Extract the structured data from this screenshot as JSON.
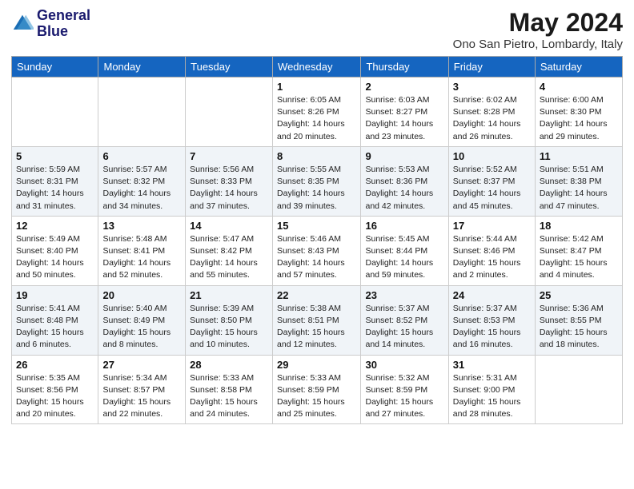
{
  "logo": {
    "line1": "General",
    "line2": "Blue"
  },
  "title": "May 2024",
  "location": "Ono San Pietro, Lombardy, Italy",
  "days_of_week": [
    "Sunday",
    "Monday",
    "Tuesday",
    "Wednesday",
    "Thursday",
    "Friday",
    "Saturday"
  ],
  "weeks": [
    [
      {
        "day": "",
        "info": ""
      },
      {
        "day": "",
        "info": ""
      },
      {
        "day": "",
        "info": ""
      },
      {
        "day": "1",
        "info": "Sunrise: 6:05 AM\nSunset: 8:26 PM\nDaylight: 14 hours\nand 20 minutes."
      },
      {
        "day": "2",
        "info": "Sunrise: 6:03 AM\nSunset: 8:27 PM\nDaylight: 14 hours\nand 23 minutes."
      },
      {
        "day": "3",
        "info": "Sunrise: 6:02 AM\nSunset: 8:28 PM\nDaylight: 14 hours\nand 26 minutes."
      },
      {
        "day": "4",
        "info": "Sunrise: 6:00 AM\nSunset: 8:30 PM\nDaylight: 14 hours\nand 29 minutes."
      }
    ],
    [
      {
        "day": "5",
        "info": "Sunrise: 5:59 AM\nSunset: 8:31 PM\nDaylight: 14 hours\nand 31 minutes."
      },
      {
        "day": "6",
        "info": "Sunrise: 5:57 AM\nSunset: 8:32 PM\nDaylight: 14 hours\nand 34 minutes."
      },
      {
        "day": "7",
        "info": "Sunrise: 5:56 AM\nSunset: 8:33 PM\nDaylight: 14 hours\nand 37 minutes."
      },
      {
        "day": "8",
        "info": "Sunrise: 5:55 AM\nSunset: 8:35 PM\nDaylight: 14 hours\nand 39 minutes."
      },
      {
        "day": "9",
        "info": "Sunrise: 5:53 AM\nSunset: 8:36 PM\nDaylight: 14 hours\nand 42 minutes."
      },
      {
        "day": "10",
        "info": "Sunrise: 5:52 AM\nSunset: 8:37 PM\nDaylight: 14 hours\nand 45 minutes."
      },
      {
        "day": "11",
        "info": "Sunrise: 5:51 AM\nSunset: 8:38 PM\nDaylight: 14 hours\nand 47 minutes."
      }
    ],
    [
      {
        "day": "12",
        "info": "Sunrise: 5:49 AM\nSunset: 8:40 PM\nDaylight: 14 hours\nand 50 minutes."
      },
      {
        "day": "13",
        "info": "Sunrise: 5:48 AM\nSunset: 8:41 PM\nDaylight: 14 hours\nand 52 minutes."
      },
      {
        "day": "14",
        "info": "Sunrise: 5:47 AM\nSunset: 8:42 PM\nDaylight: 14 hours\nand 55 minutes."
      },
      {
        "day": "15",
        "info": "Sunrise: 5:46 AM\nSunset: 8:43 PM\nDaylight: 14 hours\nand 57 minutes."
      },
      {
        "day": "16",
        "info": "Sunrise: 5:45 AM\nSunset: 8:44 PM\nDaylight: 14 hours\nand 59 minutes."
      },
      {
        "day": "17",
        "info": "Sunrise: 5:44 AM\nSunset: 8:46 PM\nDaylight: 15 hours\nand 2 minutes."
      },
      {
        "day": "18",
        "info": "Sunrise: 5:42 AM\nSunset: 8:47 PM\nDaylight: 15 hours\nand 4 minutes."
      }
    ],
    [
      {
        "day": "19",
        "info": "Sunrise: 5:41 AM\nSunset: 8:48 PM\nDaylight: 15 hours\nand 6 minutes."
      },
      {
        "day": "20",
        "info": "Sunrise: 5:40 AM\nSunset: 8:49 PM\nDaylight: 15 hours\nand 8 minutes."
      },
      {
        "day": "21",
        "info": "Sunrise: 5:39 AM\nSunset: 8:50 PM\nDaylight: 15 hours\nand 10 minutes."
      },
      {
        "day": "22",
        "info": "Sunrise: 5:38 AM\nSunset: 8:51 PM\nDaylight: 15 hours\nand 12 minutes."
      },
      {
        "day": "23",
        "info": "Sunrise: 5:37 AM\nSunset: 8:52 PM\nDaylight: 15 hours\nand 14 minutes."
      },
      {
        "day": "24",
        "info": "Sunrise: 5:37 AM\nSunset: 8:53 PM\nDaylight: 15 hours\nand 16 minutes."
      },
      {
        "day": "25",
        "info": "Sunrise: 5:36 AM\nSunset: 8:55 PM\nDaylight: 15 hours\nand 18 minutes."
      }
    ],
    [
      {
        "day": "26",
        "info": "Sunrise: 5:35 AM\nSunset: 8:56 PM\nDaylight: 15 hours\nand 20 minutes."
      },
      {
        "day": "27",
        "info": "Sunrise: 5:34 AM\nSunset: 8:57 PM\nDaylight: 15 hours\nand 22 minutes."
      },
      {
        "day": "28",
        "info": "Sunrise: 5:33 AM\nSunset: 8:58 PM\nDaylight: 15 hours\nand 24 minutes."
      },
      {
        "day": "29",
        "info": "Sunrise: 5:33 AM\nSunset: 8:59 PM\nDaylight: 15 hours\nand 25 minutes."
      },
      {
        "day": "30",
        "info": "Sunrise: 5:32 AM\nSunset: 8:59 PM\nDaylight: 15 hours\nand 27 minutes."
      },
      {
        "day": "31",
        "info": "Sunrise: 5:31 AM\nSunset: 9:00 PM\nDaylight: 15 hours\nand 28 minutes."
      },
      {
        "day": "",
        "info": ""
      }
    ]
  ]
}
